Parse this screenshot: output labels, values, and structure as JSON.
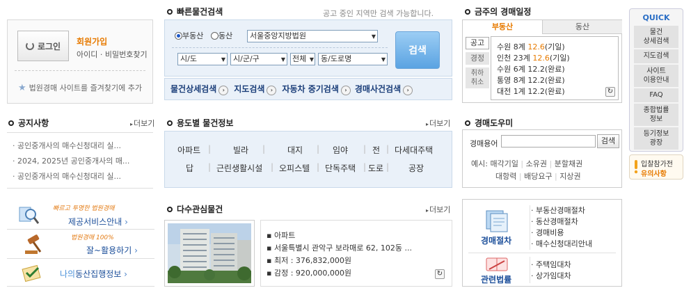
{
  "login": {
    "button_label": "로그인",
    "join_label": "회원가입",
    "find_label": "아이디 · 비밀번호찾기",
    "favorite_label": "법원경매 사이트를 즐겨찾기에 추가"
  },
  "notice": {
    "title": "공지사항",
    "more": "더보기",
    "items": [
      "공인중개사의 매수신청대리 실...",
      "2024, 2025년 공인중개사의 매...",
      "공인중개사의 매수신청대리 실..."
    ]
  },
  "side_banners": [
    {
      "tag": "빠르고 투명한 법원경매",
      "label": "제공서비스안내"
    },
    {
      "tag": "법원경매 100%",
      "label": "잘~활용하기"
    },
    {
      "label_prefix": "나의",
      "label": "동산집행정보"
    }
  ],
  "quick_search": {
    "title": "빠른물건검색",
    "note": "공고 중인 지역만 검색 가능합니다.",
    "radio_real": "부동산",
    "radio_movable": "동산",
    "court": "서울중앙지방법원",
    "sido": "시/도",
    "sigungu": "시/군/구",
    "full": "전체",
    "dong": "동/도로명",
    "search_button": "검색",
    "links": [
      "물건상세검색",
      "지도검색",
      "자동차 중기검색",
      "경매사건검색"
    ]
  },
  "usage": {
    "title": "용도별 물건정보",
    "more": "더보기",
    "row1": [
      "아파트",
      "빌라",
      "대지",
      "임야",
      "전",
      "다세대주택"
    ],
    "row2": [
      "답",
      "근린생활시설",
      "오피스텔",
      "단독주택",
      "도로",
      "공장"
    ]
  },
  "interest": {
    "title": "다수관심물건",
    "more": "더보기",
    "type": "아파트",
    "address": "서울특별시 관악구 보라매로 62, 102동 ...",
    "min_price": "최저 : 376,832,000원",
    "appraisal": "감정 : 920,000,000원"
  },
  "schedule": {
    "title": "금주의 경매일정",
    "tab_real": "부동산",
    "tab_movable": "동산",
    "side_tabs": [
      "공고",
      "경정",
      "취하\n취소"
    ],
    "rows": [
      {
        "court": "수원 8계",
        "date": "12.6",
        "status": "(기일)",
        "hl": true
      },
      {
        "court": "인천 23계",
        "date": "12.6",
        "status": "(기일)",
        "hl": true
      },
      {
        "court": "수원 6계",
        "date": "12.2",
        "status": "(완료)",
        "hl": false
      },
      {
        "court": "통영 8계",
        "date": "12.2",
        "status": "(완료)",
        "hl": false
      },
      {
        "court": "대전 1계",
        "date": "12.2",
        "status": "(완료)",
        "hl": false
      }
    ]
  },
  "helper": {
    "title": "경매도우미",
    "label": "경매용어",
    "button": "검색",
    "example": "예시:",
    "terms1": [
      "매각기일",
      "소유권",
      "분할채권"
    ],
    "terms2": [
      "대항력",
      "배당요구",
      "지상권"
    ]
  },
  "procedure": {
    "label1": "경매절차",
    "items1": [
      "부동산경매절차",
      "동산경매절차",
      "경매비용",
      "매수신청대리안내"
    ],
    "label2": "관련법률",
    "items2": [
      "주택임대차",
      "상가임대차"
    ]
  },
  "quick": {
    "title": "QUICK",
    "items": [
      "물건\n상세검색",
      "지도검색",
      "사이트\n이용안내",
      "FAQ",
      "종합법률\n정보",
      "등기정보\n광장"
    ],
    "notice_prefix": "입찰참가전",
    "notice": "유의사항"
  }
}
